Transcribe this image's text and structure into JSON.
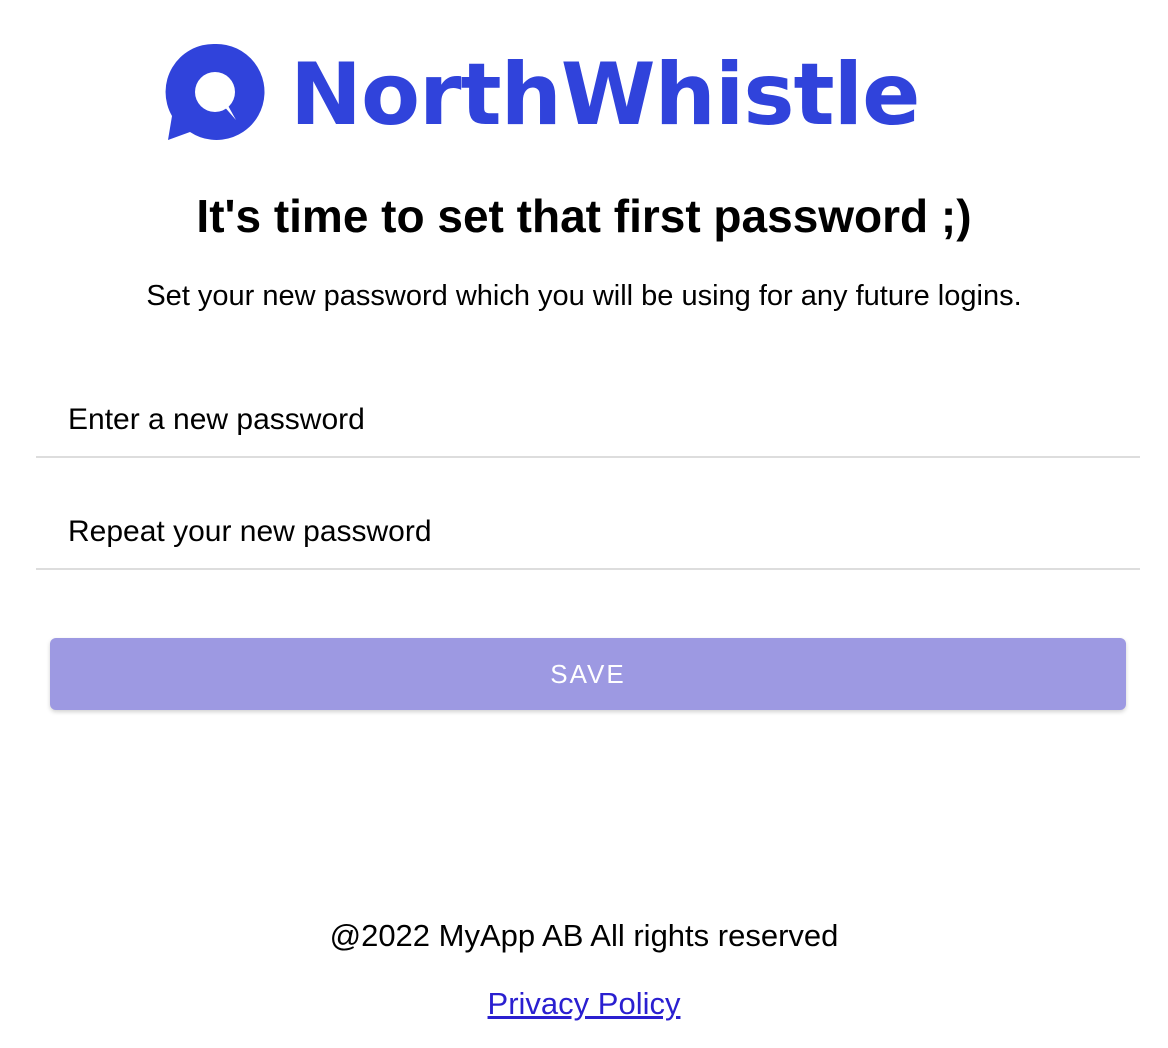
{
  "brand": {
    "name": "NorthWhistle",
    "color": "#3043db",
    "logo_icon": "speech-bubble-icon"
  },
  "heading": "It's time to set that first password ;)",
  "description": "Set your new password which you will be using for any future logins.",
  "form": {
    "new_password": {
      "placeholder": "Enter a new password",
      "value": ""
    },
    "repeat_password": {
      "placeholder": "Repeat your new password",
      "value": ""
    },
    "save_label": "SAVE",
    "save_color": "#9d99e2"
  },
  "footer": {
    "copyright": "@2022 MyApp AB All rights reserved",
    "privacy_link": "Privacy Policy",
    "link_color": "#2a1fd0"
  }
}
